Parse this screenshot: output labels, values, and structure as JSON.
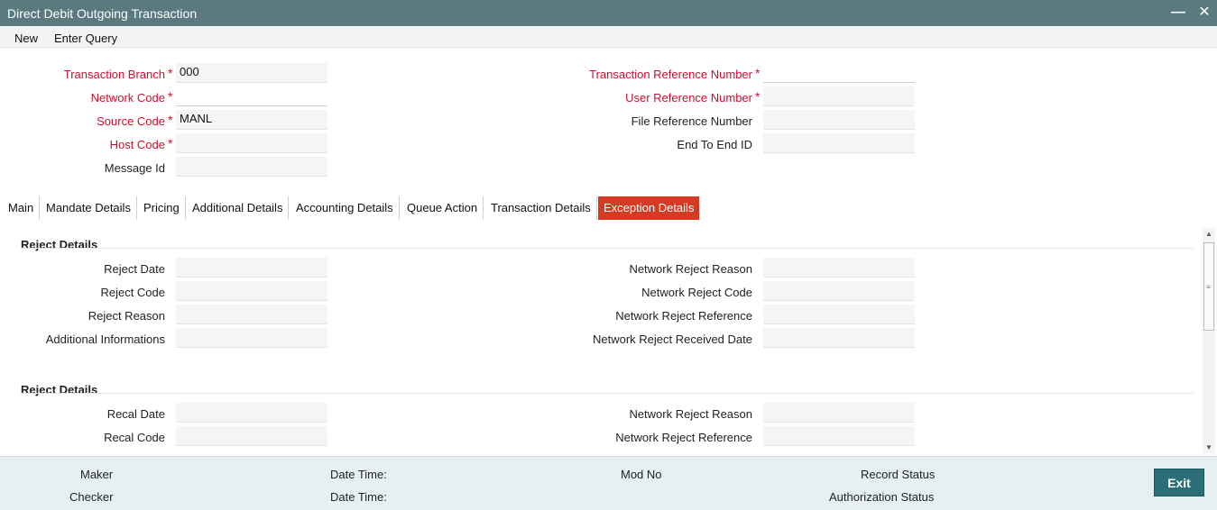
{
  "window": {
    "title": "Direct Debit Outgoing Transaction",
    "minimize_glyph": "—",
    "close_glyph": "✕"
  },
  "menu": {
    "new": "New",
    "enter_query": "Enter Query"
  },
  "header_fields": {
    "transaction_branch": {
      "label": "Transaction Branch",
      "value": "000"
    },
    "network_code": {
      "label": "Network Code",
      "value": ""
    },
    "source_code": {
      "label": "Source Code",
      "value": "MANL"
    },
    "host_code": {
      "label": "Host Code",
      "value": ""
    },
    "message_id": {
      "label": "Message Id",
      "value": ""
    },
    "transaction_reference_number": {
      "label": "Transaction Reference Number",
      "value": ""
    },
    "user_reference_number": {
      "label": "User Reference Number",
      "value": ""
    },
    "file_reference_number": {
      "label": "File Reference Number",
      "value": ""
    },
    "end_to_end_id": {
      "label": "End To End ID",
      "value": ""
    }
  },
  "required_marker": "*",
  "tabs": [
    {
      "label": "Main"
    },
    {
      "label": "Mandate Details"
    },
    {
      "label": "Pricing"
    },
    {
      "label": "Additional Details"
    },
    {
      "label": "Accounting Details"
    },
    {
      "label": "Queue Action"
    },
    {
      "label": "Transaction Details"
    },
    {
      "label": "Exception Details",
      "active": true
    }
  ],
  "reject_section": {
    "title": "Reject Details",
    "reject_date": {
      "label": "Reject Date",
      "value": ""
    },
    "reject_code": {
      "label": "Reject Code",
      "value": ""
    },
    "reject_reason": {
      "label": "Reject Reason",
      "value": ""
    },
    "additional_informations": {
      "label": "Additional Informations",
      "value": ""
    },
    "network_reject_reason": {
      "label": "Network Reject Reason",
      "value": ""
    },
    "network_reject_code": {
      "label": "Network Reject Code",
      "value": ""
    },
    "network_reject_reference": {
      "label": "Network Reject Reference",
      "value": ""
    },
    "network_reject_received_date": {
      "label": "Network Reject Received Date",
      "value": ""
    }
  },
  "recall_section": {
    "title": "Reject Details",
    "recal_date": {
      "label": "Recal Date",
      "value": ""
    },
    "recal_code": {
      "label": "Recal Code",
      "value": ""
    },
    "network_reject_reason": {
      "label": "Network Reject Reason",
      "value": ""
    },
    "network_reject_reference": {
      "label": "Network Reject Reference",
      "value": ""
    }
  },
  "footer": {
    "maker": "Maker",
    "checker": "Checker",
    "date_time_1": "Date Time:",
    "date_time_2": "Date Time:",
    "mod_no": "Mod No",
    "record_status": "Record Status",
    "authorization_status": "Authorization Status",
    "exit": "Exit"
  },
  "colors": {
    "titlebar": "#5a7a80",
    "required_label": "#c8102e",
    "active_tab": "#d63a22",
    "footer_bg": "#e6f0f0",
    "exit_button": "#2b6e78"
  }
}
